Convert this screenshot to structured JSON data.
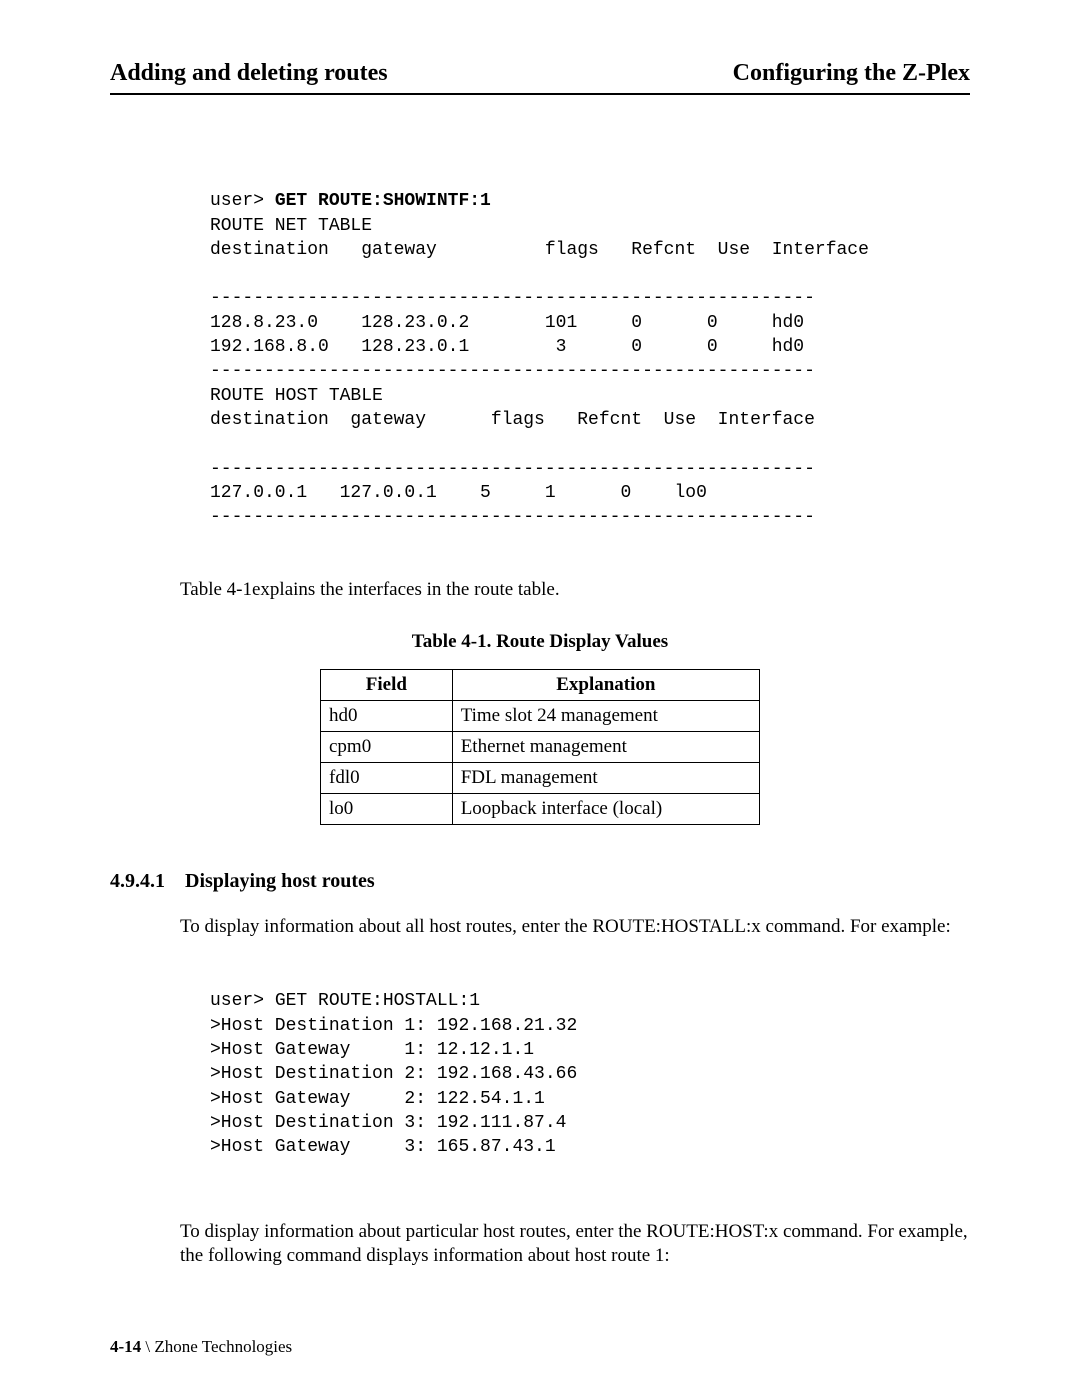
{
  "header": {
    "left": "Adding and deleting routes",
    "right": "Configuring the Z-Plex"
  },
  "terminal1": {
    "prompt": "user> ",
    "command": "GET ROUTE:SHOWINTF:1",
    "lines": [
      "ROUTE NET TABLE",
      "destination   gateway          flags   Refcnt  Use  Interface",
      "",
      "--------------------------------------------------------",
      "128.8.23.0    128.23.0.2       101     0      0     hd0",
      "192.168.8.0   128.23.0.1        3      0      0     hd0",
      "--------------------------------------------------------",
      "ROUTE HOST TABLE",
      "destination  gateway      flags   Refcnt  Use  Interface",
      "",
      "--------------------------------------------------------",
      "127.0.0.1   127.0.0.1    5     1      0    lo0",
      "--------------------------------------------------------"
    ]
  },
  "caption_para": "Table 4-1explains the interfaces in the route table.",
  "table_caption": "Table 4-1. Route Display Values",
  "table": {
    "head": {
      "field": "Field",
      "explanation": "Explanation"
    },
    "rows": [
      {
        "field": "hd0",
        "explanation": "Time slot 24 management"
      },
      {
        "field": "cpm0",
        "explanation": "Ethernet management"
      },
      {
        "field": "fdl0",
        "explanation": "FDL management"
      },
      {
        "field": "lo0",
        "explanation": "Loopback interface (local)"
      }
    ]
  },
  "section": {
    "number": "4.9.4.1",
    "title": "Displaying host routes"
  },
  "para1": "To display information about all host routes, enter the ROUTE:HOSTALL:x command. For example:",
  "terminal2": {
    "prompt": "user> ",
    "command": "GET ROUTE:HOSTALL:1",
    "lines": [
      ">Host Destination 1: 192.168.21.32",
      ">Host Gateway     1: 12.12.1.1",
      ">Host Destination 2: 192.168.43.66",
      ">Host Gateway     2: 122.54.1.1",
      ">Host Destination 3: 192.111.87.4",
      ">Host Gateway     3: 165.87.43.1"
    ]
  },
  "para2": "To display information about particular host routes, enter the ROUTE:HOST:x command. For example, the following command displays information about host route 1:",
  "footer": {
    "page": "4-14",
    "sep": " \\ ",
    "company": "Zhone Technologies"
  }
}
